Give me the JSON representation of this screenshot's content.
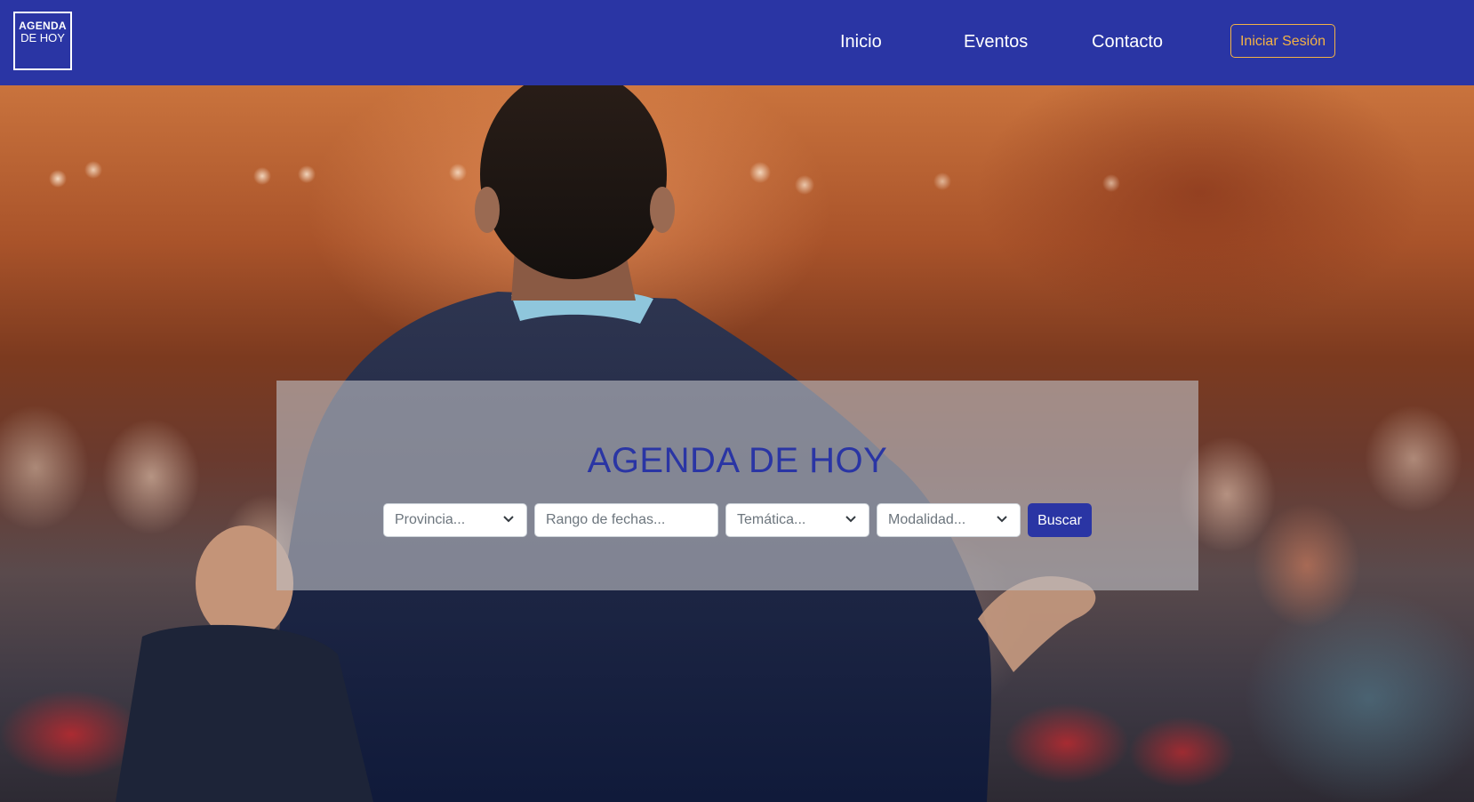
{
  "brand": {
    "logo_line1": "AGENDA",
    "logo_line2": "DE HOY",
    "primary_color": "#2a35a4",
    "accent_color": "#f3b245"
  },
  "nav": {
    "items": [
      {
        "label": "Inicio"
      },
      {
        "label": "Eventos"
      },
      {
        "label": "Contacto"
      }
    ],
    "login_label": "Iniciar Sesión"
  },
  "hero": {
    "image_icon": "conference-speaker-photo",
    "title": "AGENDA DE HOY",
    "search": {
      "provincia_placeholder": "Provincia...",
      "fechas_placeholder": "Rango de fechas...",
      "tematica_placeholder": "Temática...",
      "modalidad_placeholder": "Modalidad...",
      "button_label": "Buscar"
    }
  }
}
